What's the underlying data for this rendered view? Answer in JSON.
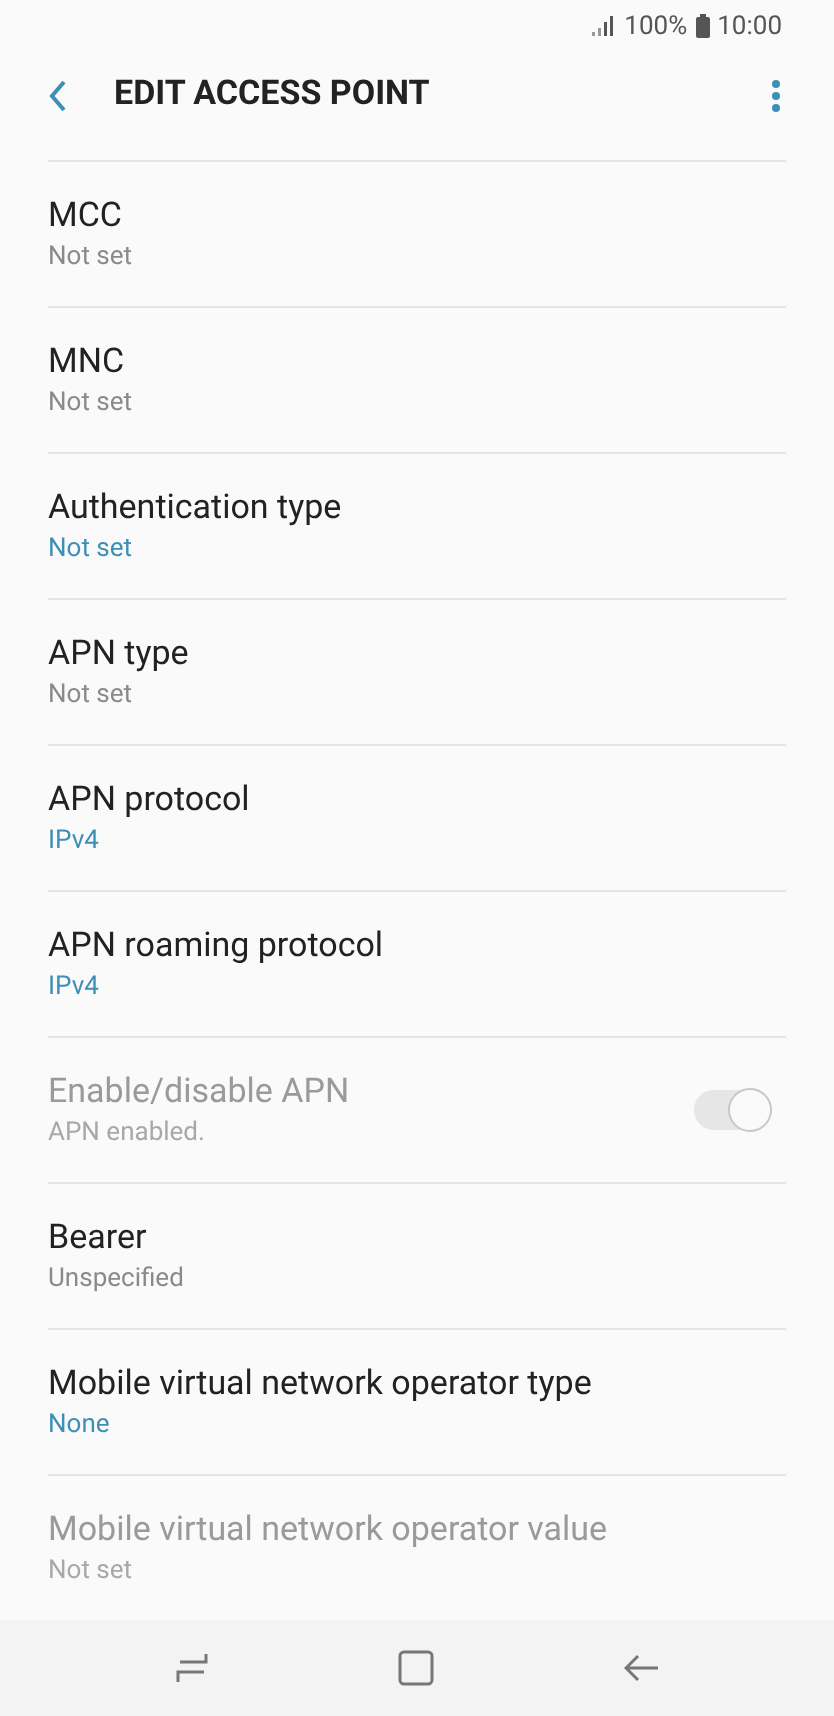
{
  "status_bar": {
    "battery": "100%",
    "time": "10:00"
  },
  "header": {
    "title": "EDIT ACCESS POINT"
  },
  "settings": [
    {
      "kind": "text",
      "label": "MCC",
      "value": "Not set",
      "accent": false,
      "disabled": false
    },
    {
      "kind": "text",
      "label": "MNC",
      "value": "Not set",
      "accent": false,
      "disabled": false
    },
    {
      "kind": "text",
      "label": "Authentication type",
      "value": "Not set",
      "accent": true,
      "disabled": false
    },
    {
      "kind": "text",
      "label": "APN type",
      "value": "Not set",
      "accent": false,
      "disabled": false
    },
    {
      "kind": "text",
      "label": "APN protocol",
      "value": "IPv4",
      "accent": true,
      "disabled": false
    },
    {
      "kind": "text",
      "label": "APN roaming protocol",
      "value": "IPv4",
      "accent": true,
      "disabled": false
    },
    {
      "kind": "toggle",
      "label": "Enable/disable APN",
      "value": "APN enabled.",
      "disabled": true,
      "on": true
    },
    {
      "kind": "text",
      "label": "Bearer",
      "value": "Unspecified",
      "accent": false,
      "disabled": false
    },
    {
      "kind": "text",
      "label": "Mobile virtual network operator type",
      "value": "None",
      "accent": true,
      "disabled": false
    },
    {
      "kind": "text",
      "label": "Mobile virtual network operator value",
      "value": "Not set",
      "disabled": true
    }
  ]
}
